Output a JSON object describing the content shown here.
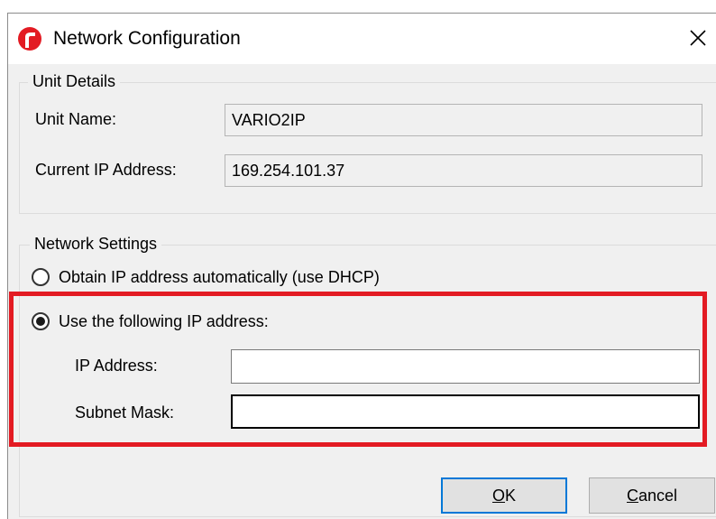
{
  "window": {
    "title": "Network Configuration",
    "close_glyph": "✕",
    "logo_icon": "app-logo-icon",
    "accent_color": "#e31b23"
  },
  "unit_details": {
    "legend": "Unit Details",
    "unit_name_label": "Unit Name:",
    "unit_name_value": "VARIO2IP",
    "current_ip_label": "Current IP Address:",
    "current_ip_value": "169.254.101.37"
  },
  "network_settings": {
    "legend": "Network Settings",
    "dhcp_option_label": "Obtain IP address automatically (use DHCP)",
    "dhcp_selected": false,
    "static_option_label": "Use the following IP address:",
    "static_selected": true,
    "ip_address_label": "IP Address:",
    "ip_address_value": "",
    "subnet_mask_label": "Subnet Mask:",
    "subnet_mask_value": ""
  },
  "buttons": {
    "ok_mnemonic": "O",
    "ok_rest": "K",
    "cancel_mnemonic": "C",
    "cancel_rest": "ancel"
  },
  "highlight_color": "#e31b23",
  "default_button_color": "#0078d7"
}
